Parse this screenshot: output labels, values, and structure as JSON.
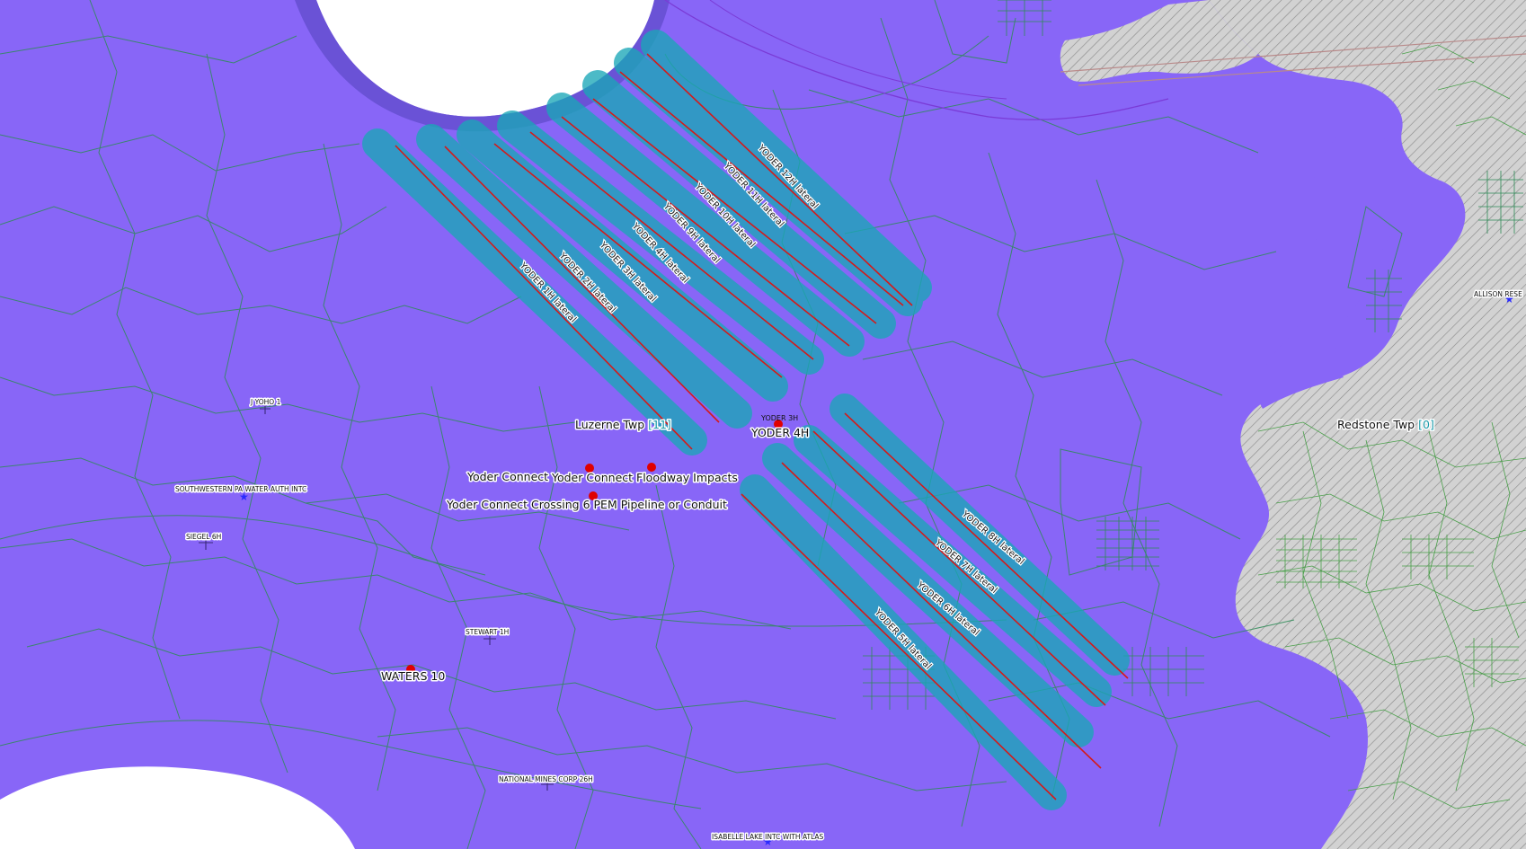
{
  "map": {
    "colors": {
      "township": "#8866f7",
      "township_dark": "#6a52d6",
      "outside": "#ffffff",
      "hatched": "#cfcfcf",
      "parcels": "#2e8b57",
      "parcels_outside": "#3b9a3b",
      "buffer": "#1aa7b8",
      "lateral": "#d41a1a",
      "point_marker": "#e00000",
      "star": "#2a2aff"
    },
    "townships": {
      "luzerne": {
        "name": "Luzerne Twp",
        "count": "[11]"
      },
      "redstone": {
        "name": "Redstone Twp",
        "count": "[0]"
      }
    },
    "laterals": [
      "YODER 1H lateral",
      "YODER 2H lateral",
      "YODER 3H lateral",
      "YODER 4H lateral",
      "YODER 9H lateral",
      "YODER 10H lateral",
      "YODER 11H lateral",
      "YODER 12H lateral",
      "YODER 8H lateral",
      "YODER 7H lateral",
      "YODER 6H lateral",
      "YODER 5H lateral"
    ],
    "features": {
      "yoder_4h": "YODER 4H",
      "yoder_3h": "YODER 3H",
      "waters_10": "WATERS 10",
      "floodway": "Yoder Connect Floodway Impacts",
      "floodway_overlap": "Yoder Connect",
      "crossing": "Yoder Connect Crossing 6 PEM Pipeline or Conduit"
    },
    "wells": {
      "jyoho": "J YOHO 1",
      "southwestern": "SOUTHWESTERN PA WATER AUTH INTC",
      "siegel": "SIEGEL 6H",
      "stewart": "STEWART 1H",
      "national_mines": "NATIONAL MINES CORP 26H",
      "isabelle": "ISABELLE LAKE INTC WITH ATLAS",
      "allison": "ALLISON RESE"
    }
  }
}
